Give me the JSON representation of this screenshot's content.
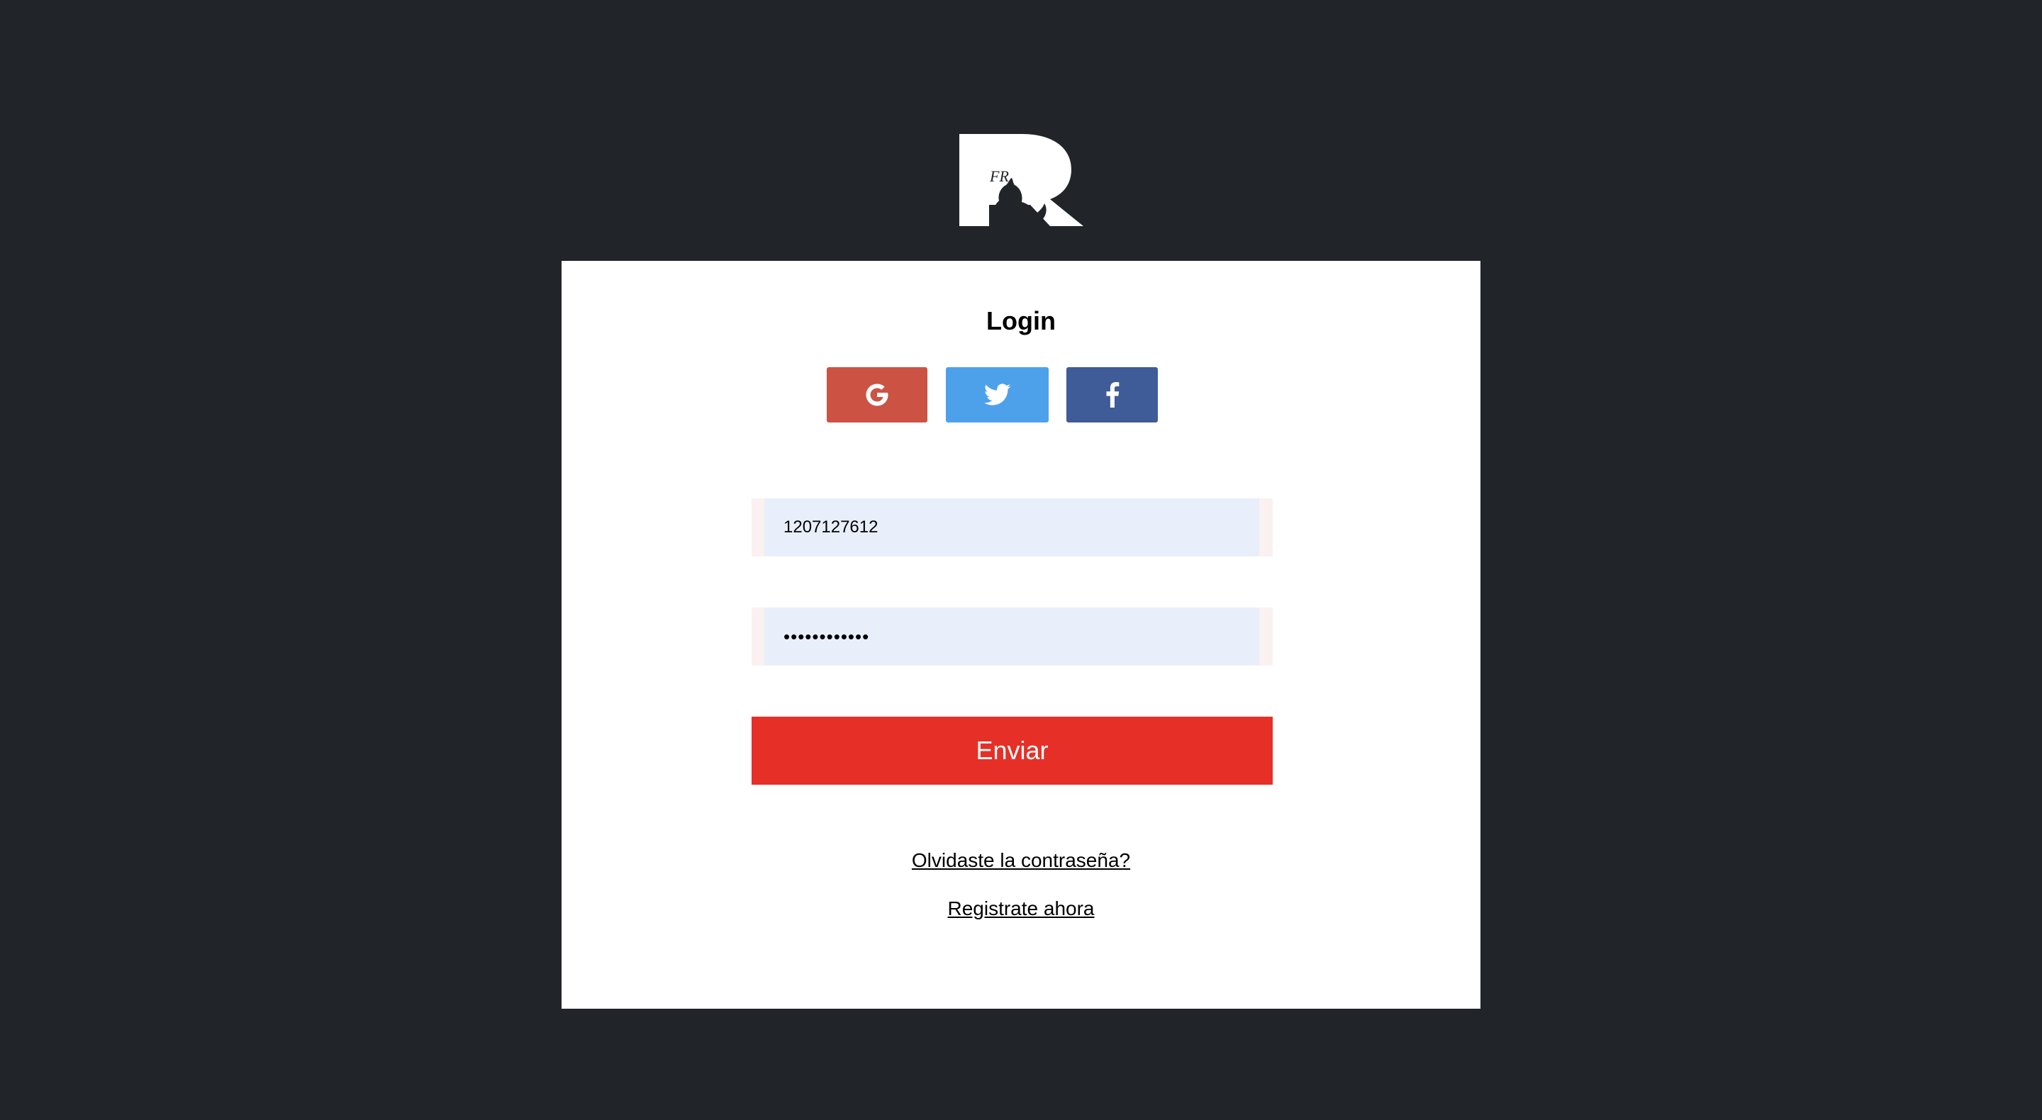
{
  "logo": {
    "label": "FR",
    "icon": "wolf-r-logo-icon"
  },
  "login": {
    "title": "Login",
    "social": [
      {
        "name": "google",
        "icon": "google-icon",
        "color": "#cc5343"
      },
      {
        "name": "twitter",
        "icon": "twitter-icon",
        "color": "#4da1eb"
      },
      {
        "name": "facebook",
        "icon": "facebook-icon",
        "color": "#3f5b98"
      }
    ],
    "username_value": "1207127612",
    "password_value": "123456789012",
    "submit_label": "Enviar",
    "forgot_link": "Olvidaste la contraseña?",
    "register_link": "Registrate ahora"
  },
  "colors": {
    "background": "#212428",
    "card": "#ffffff",
    "submit": "#e63027",
    "input_fill": "#e8effb"
  }
}
